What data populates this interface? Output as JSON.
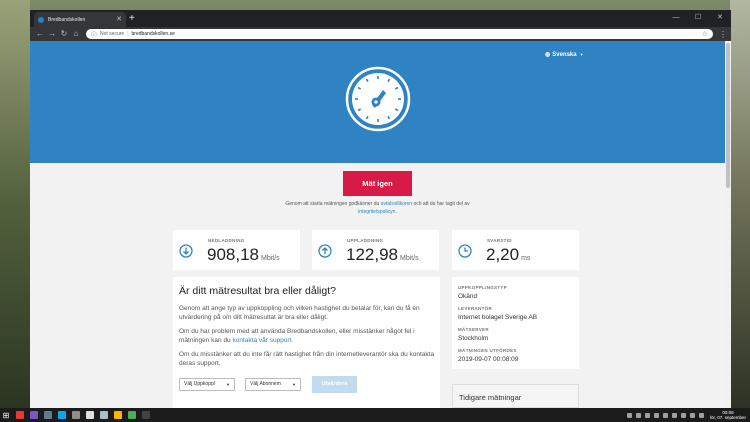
{
  "browser": {
    "tab_title": "Bredbandskollen",
    "new_tab": "+",
    "url_security": "Not secure",
    "url": "bredbandskollen.se",
    "window_controls": [
      "—",
      "☐",
      "✕"
    ]
  },
  "page": {
    "language": "Svenska",
    "measure_button": "Mät igen",
    "legal": {
      "before": "Genom att starta mätningen godkänner du",
      "terms_link": "avtalsvillkoren",
      "middle": "och att du har tagit del av",
      "privacy_link": "integritetspolicyn",
      "end": "."
    },
    "stats": [
      {
        "label": "NEDLADDNING",
        "value": "908,18",
        "unit": "Mbit/s",
        "icon": "download-arrow-icon"
      },
      {
        "label": "UPPLADDNING",
        "value": "122,98",
        "unit": "Mbit/s",
        "icon": "upload-arrow-icon"
      },
      {
        "label": "SVARSTID",
        "value": "2,20",
        "unit": "ms",
        "icon": "clock-icon"
      }
    ],
    "quality": {
      "title": "Är ditt mätresultat bra eller dåligt?",
      "p1": "Genom att ange typ av uppkoppling och vilken hastighet du betalar för, kan du få en utvärdering på om ditt mätresultat är bra eller dåligt.",
      "p2_before": "Om du har problem med att använda Bredbandskollen, eller misstänker något fel i mätningen kan du",
      "p2_link": "kontakta vår support",
      "p2_end": ".",
      "p3": "Om du misstänker att du inte får rätt hastighet från din internetleverantör ska du kontakta deras support.",
      "select_connection": "Välj Uppkoppl",
      "select_subscription": "Välj Abonnem",
      "evaluate_button": "Utvärdera"
    },
    "info": [
      {
        "label": "UPPKOPPLINGSTYP",
        "value": "Okänd"
      },
      {
        "label": "LEVERANTÖR",
        "value": "Internet bolaget Sverige AB"
      },
      {
        "label": "MÄTSERVER",
        "value": "Stockholm"
      },
      {
        "label": "MÄTNINGEN UTFÖRDES",
        "value": "2019-09-07 00:08:09"
      }
    ],
    "previous_title": "Tidigare mätningar"
  },
  "taskbar": {
    "clock_time": "00:08",
    "clock_date": "lör, 07. september"
  },
  "colors": {
    "hero": "#2f83c2",
    "cta": "#d71a47",
    "evaluate_disabled": "#c3dbef"
  }
}
